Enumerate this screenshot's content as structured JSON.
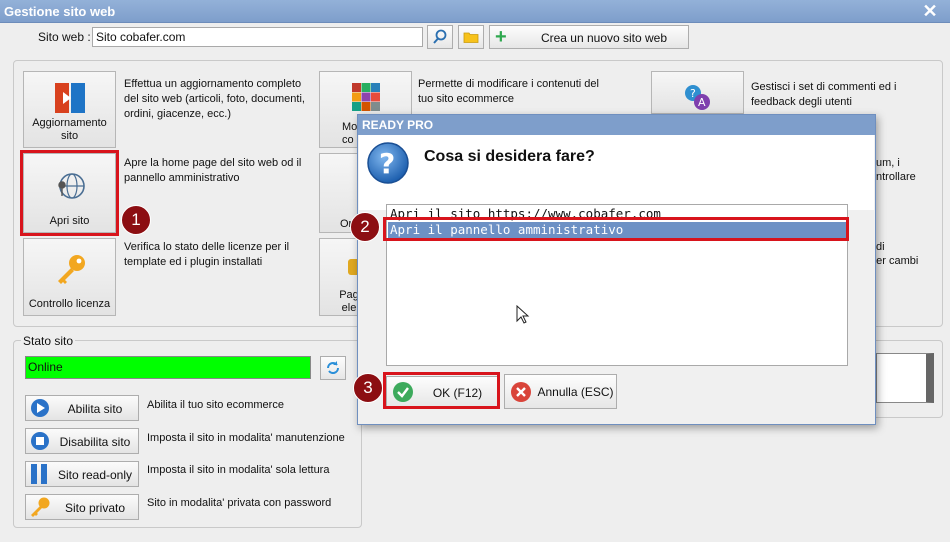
{
  "window": {
    "title": "Gestione sito web",
    "close_glyph": "✕"
  },
  "toolbar": {
    "site_label": "Sito web :",
    "site_value": "Sito cobafer.com",
    "create_button": "Crea un nuovo sito web"
  },
  "tiles": [
    {
      "label": "Aggiornamento sito",
      "desc": "Effettua un aggiornamento completo del sito web (articoli, foto, documenti, ordini, giacenze, ecc.)",
      "icon": "update-icon"
    },
    {
      "label": "Apri sito",
      "desc": "Apre la home page del sito web od il pannello amministrativo",
      "icon": "globe-pin-icon"
    },
    {
      "label": "Controllo licenza",
      "desc": "Verifica lo stato delle licenze per il template ed i plugin installati",
      "icon": "key-icon"
    }
  ],
  "col2": {
    "tile1_partial": "Mo co",
    "tile2_partial": "Or",
    "tile3_partial": "Pag ele",
    "desc1": "Permette di modificare i contenuti del tuo sito ecommerce"
  },
  "col3": {
    "desc1": "Gestisci i set di commenti ed i feedback degli utenti",
    "desc2_partial_a": "um, i",
    "desc2_partial_b": "ntrollare",
    "desc3_partial_a": "di",
    "desc3_partial_b": "per cambi"
  },
  "stato": {
    "legend": "Stato sito",
    "value": "Online",
    "buttons": [
      {
        "label": "Abilita sito",
        "desc": "Abilita il tuo sito ecommerce",
        "icon": "play-icon"
      },
      {
        "label": "Disabilita sito",
        "desc": "Imposta il sito in modalita' manutenzione",
        "icon": "stop-icon"
      },
      {
        "label": "Sito read-only",
        "desc": "Imposta il sito in modalita' sola lettura",
        "icon": "pause-icon"
      },
      {
        "label": "Sito privato",
        "desc": "Sito in modalita' privata con password",
        "icon": "key-icon"
      }
    ]
  },
  "dialog": {
    "title": "READY PRO",
    "question": "Cosa si desidera fare?",
    "options": [
      "Apri il sito https://www.cobafer.com",
      "Apri il pannello amministrativo"
    ],
    "selected_index": 1,
    "ok_button": "OK (F12)",
    "cancel_button": "Annulla (ESC)"
  },
  "annotations": [
    "1",
    "2",
    "3"
  ],
  "colors": {
    "titlebar": "#7e9ecb",
    "online_green": "#00ff00",
    "annotation_red": "#d8141c",
    "selected_row": "#6d91c5"
  }
}
